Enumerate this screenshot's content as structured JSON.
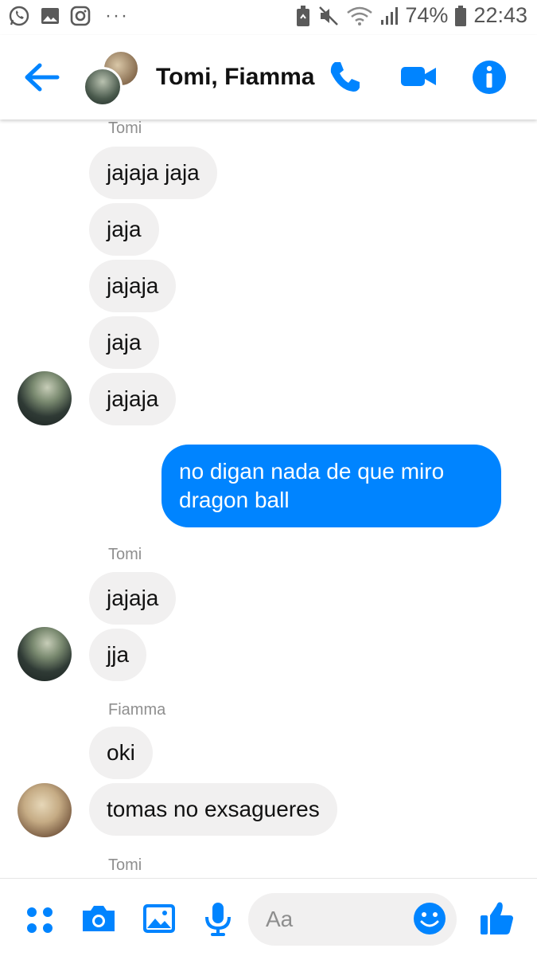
{
  "status_bar": {
    "battery_percent": "74%",
    "time": "22:43",
    "left_icons": [
      "whatsapp-icon",
      "image-icon",
      "instagram-icon"
    ],
    "overflow": "···"
  },
  "header": {
    "title": "Tomi, Fiamma",
    "buttons": [
      "back-arrow-icon",
      "phone-icon",
      "video-camera-icon",
      "info-icon"
    ]
  },
  "messages": [
    {
      "type": "sender",
      "text": "Tomi"
    },
    {
      "type": "in",
      "sender": "Tomi",
      "text": "jajaja jaja"
    },
    {
      "type": "in",
      "sender": "Tomi",
      "text": "jaja"
    },
    {
      "type": "in",
      "sender": "Tomi",
      "text": "jajaja"
    },
    {
      "type": "in",
      "sender": "Tomi",
      "text": "jaja"
    },
    {
      "type": "in",
      "sender": "Tomi",
      "text": "jajaja"
    },
    {
      "type": "out",
      "text": "no digan nada de que miro dragon ball"
    },
    {
      "type": "sender",
      "text": "Tomi"
    },
    {
      "type": "in",
      "sender": "Tomi",
      "text": "jajaja"
    },
    {
      "type": "in",
      "sender": "Tomi",
      "text": "jja"
    },
    {
      "type": "sender",
      "text": "Fiamma"
    },
    {
      "type": "in",
      "sender": "Fiamma",
      "text": "oki"
    },
    {
      "type": "in",
      "sender": "Fiamma",
      "text": "tomas no exsagueres"
    },
    {
      "type": "sender",
      "text": "Tomi"
    }
  ],
  "composer": {
    "placeholder": "Aa",
    "icons": [
      "apps-icon",
      "camera-icon",
      "gallery-icon",
      "microphone-icon",
      "emoji-icon",
      "thumbs-up-icon"
    ]
  },
  "colors": {
    "accent": "#0084ff",
    "incoming_bubble": "#f1f0f0",
    "sender_label": "#8f8f8f"
  }
}
